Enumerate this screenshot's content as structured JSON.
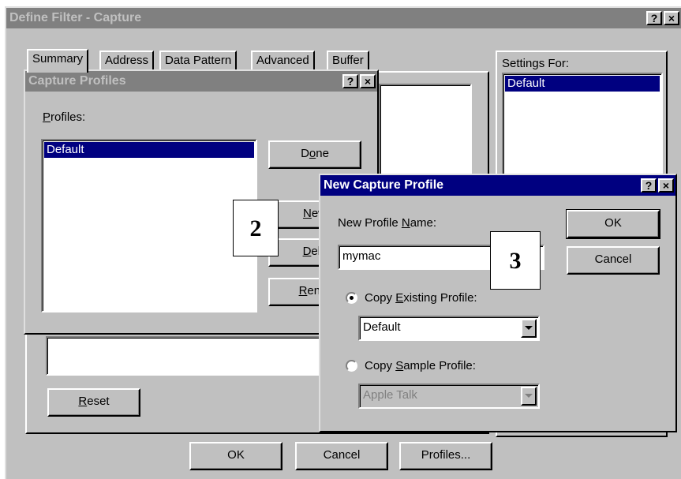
{
  "define_filter": {
    "title": "Define Filter - Capture",
    "help_btn": "?",
    "close_btn": "×",
    "tabs": [
      "Summary",
      "Address",
      "Data Pattern",
      "Advanced",
      "Buffer"
    ],
    "settings_for_label": "Settings For:",
    "settings_selected": "Default",
    "reset_pre": "",
    "reset_key": "R",
    "reset_post": "eset",
    "ok_label": "OK",
    "cancel_label": "Cancel",
    "profiles_label": "Profiles..."
  },
  "capture_profiles": {
    "title": "Capture Profiles",
    "help_btn": "?",
    "close_btn": "×",
    "profiles_label_key": "P",
    "profiles_label_rest": "rofiles:",
    "selected_profile": "Default",
    "done_pre": "D",
    "done_key": "o",
    "done_post": "ne",
    "new_key": "N",
    "new_post": "ew",
    "delete_key": "D",
    "delete_post": "ele",
    "rename_key": "R",
    "rename_post": "enar"
  },
  "new_capture_profile": {
    "title": "New Capture Profile",
    "help_btn": "?",
    "close_btn": "×",
    "name_label_pre": "New Profile ",
    "name_label_key": "N",
    "name_label_post": "ame:",
    "name_value": "mymac",
    "ok_label": "OK",
    "cancel_label": "Cancel",
    "copy_existing_pre": "Copy ",
    "copy_existing_key": "E",
    "copy_existing_post": "xisting Profile:",
    "existing_value": "Default",
    "copy_sample_pre": "Copy ",
    "copy_sample_key": "S",
    "copy_sample_post": "ample Profile:",
    "sample_value": "Apple Talk"
  },
  "callouts": {
    "step2": "2",
    "step3": "3"
  }
}
